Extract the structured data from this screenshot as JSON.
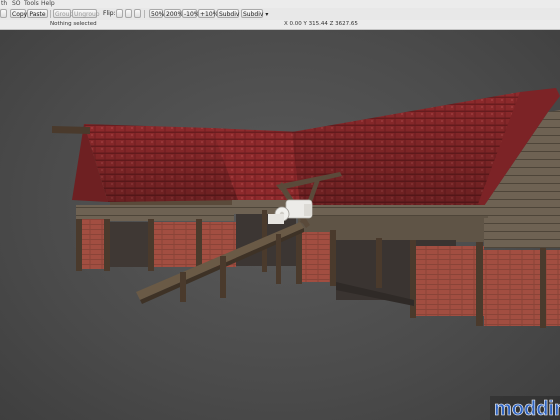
{
  "menu": {
    "items": [
      "th",
      "SO",
      "Tools",
      "Help"
    ]
  },
  "toolbar": {
    "copy": "Copy",
    "paste": "Paste",
    "group": "Group",
    "ungroup": "Ungroup",
    "flip_label": "Flip:",
    "zoom_50": "50%",
    "zoom_200": "200%",
    "zoom_minus10": "-10%",
    "zoom_plus10": "+10%",
    "subdiv1": "Subdiv",
    "subdiv2": "Subdiv"
  },
  "status": {
    "selection": "Nothing selected",
    "coordinates": "X 0.00 Y 315.44 Z 3627.65"
  },
  "watermark": {
    "text": "moddin"
  },
  "colors": {
    "viewport_bg": "#4a4a4a",
    "roof_red": "#8e2a2c",
    "brick": "#9c4a3e",
    "timber": "#4a3a2c",
    "plank": "#6e6253",
    "watermark_blue": "#1f4fa3"
  }
}
